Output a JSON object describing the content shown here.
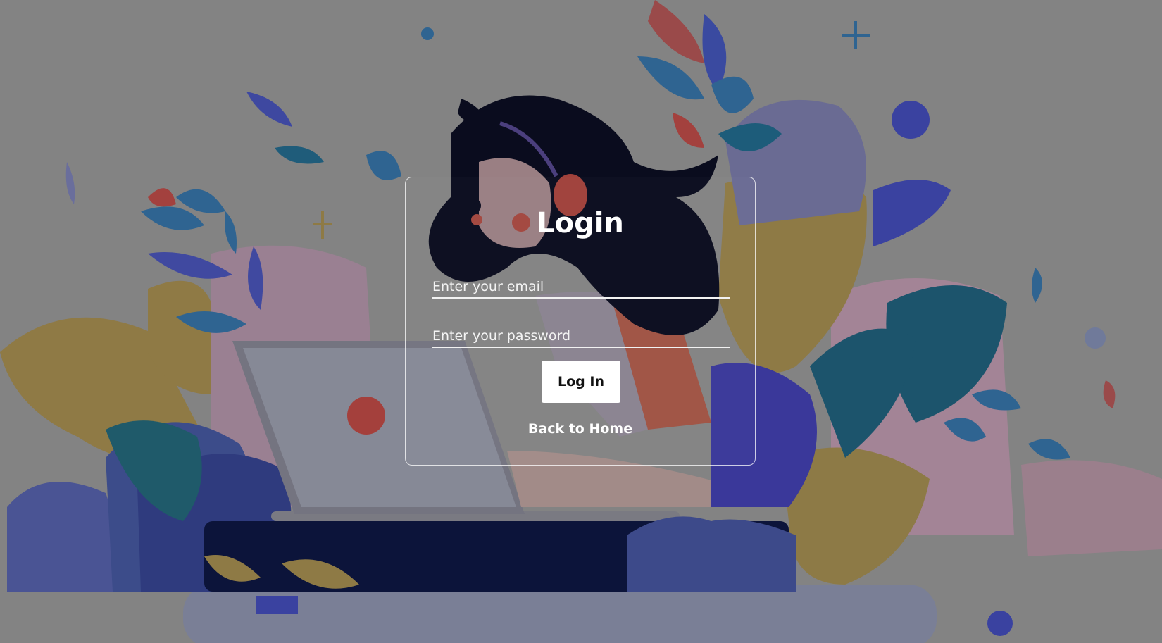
{
  "login": {
    "title": "Login",
    "email_placeholder": "Enter your email",
    "password_placeholder": "Enter your password",
    "login_button": "Log In",
    "back_link": "Back to Home"
  },
  "colors": {
    "overlay": "#838383",
    "text": "#ffffff",
    "button_bg": "#ffffff"
  }
}
